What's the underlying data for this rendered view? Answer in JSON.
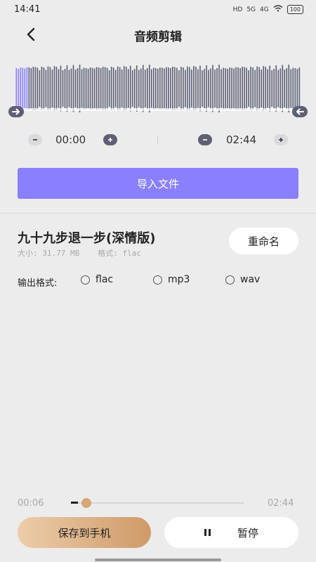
{
  "status_bar": {
    "time": "14:41",
    "hd": "HD",
    "net1": "5G",
    "net2": "4G",
    "battery": "100"
  },
  "header": {
    "title": "音频剪辑"
  },
  "icons": {
    "back": "chevron-left-icon",
    "left_handle": "arrow-right-icon",
    "right_handle": "arrow-left-icon",
    "minus": "minus-icon",
    "plus": "plus-icon",
    "pause": "pause-icon"
  },
  "trim": {
    "start_time": "00:00",
    "end_time": "02:44"
  },
  "import_button": "导入文件",
  "file": {
    "name": "九十九步退一步(深情版)",
    "size": "大小: 31.77 MB",
    "format": "格式: flac"
  },
  "rename_button": "重命名",
  "output": {
    "label": "输出格式:",
    "options": [
      "flac",
      "mp3",
      "wav"
    ]
  },
  "player": {
    "current_time": "00:06",
    "total_time": "02:44",
    "progress": 0.04
  },
  "save_button": "保存到手机",
  "pause_button": "暂停",
  "colors": {
    "accent": "#8a80ff",
    "waveform": "#5d6075",
    "waveform_selected": "#8a80ff",
    "save_gradient_start": "#eccdaa",
    "save_gradient_end": "#cf9a68"
  }
}
